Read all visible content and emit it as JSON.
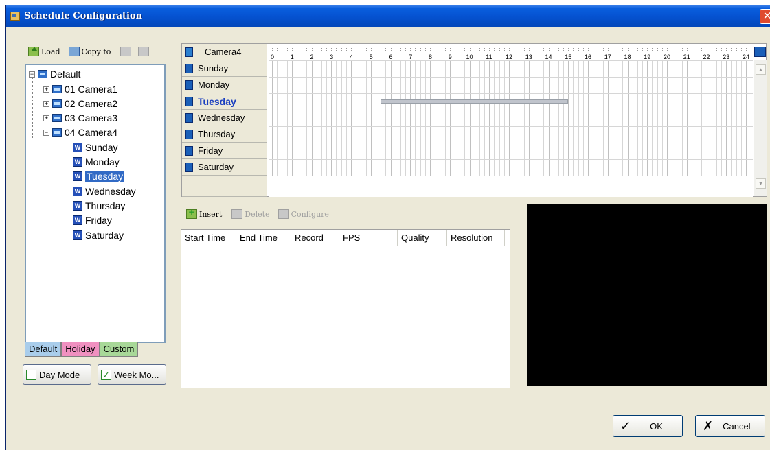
{
  "window": {
    "title": "Schedule Configuration",
    "close": "✕"
  },
  "left_toolbar": {
    "load": "Load",
    "copy_to": "Copy to"
  },
  "tree": {
    "root": "Default",
    "cameras": [
      "01 Camera1",
      "02 Camera2",
      "03 Camera3",
      "04 Camera4"
    ],
    "days": [
      "Sunday",
      "Monday",
      "Tuesday",
      "Wednesday",
      "Thursday",
      "Friday",
      "Saturday"
    ],
    "selected": "Tuesday"
  },
  "tabs": [
    "Default",
    "Holiday",
    "Custom"
  ],
  "modes": {
    "day": "Day Mode",
    "week": "Week Mo..."
  },
  "schedule": {
    "camera": "Camera4",
    "days": [
      "Sunday",
      "Monday",
      "Tuesday",
      "Wednesday",
      "Thursday",
      "Friday",
      "Saturday"
    ],
    "active_day": "Tuesday",
    "hours": [
      "0",
      "1",
      "2",
      "3",
      "4",
      "5",
      "6",
      "7",
      "8",
      "9",
      "10",
      "11",
      "12",
      "13",
      "14",
      "15",
      "16",
      "17",
      "18",
      "19",
      "20",
      "21",
      "22",
      "23",
      "24"
    ],
    "bars": [
      {
        "day": "Tuesday",
        "start": 5.5,
        "end": 15.0
      }
    ]
  },
  "entry_toolbar": {
    "insert": "Insert",
    "delete": "Delete",
    "configure": "Configure"
  },
  "list": {
    "columns": [
      "Start Time",
      "End Time",
      "Record",
      "FPS",
      "Quality",
      "Resolution"
    ]
  },
  "buttons": {
    "ok": "OK",
    "cancel": "Cancel",
    "ok_glyph": "✓",
    "cancel_glyph": "✗"
  },
  "colors": {
    "title_bar": "#0552d1",
    "selection": "#316ac5",
    "tab_default": "#a9cdeb",
    "tab_holiday": "#f090c0",
    "tab_custom": "#a8d898"
  }
}
